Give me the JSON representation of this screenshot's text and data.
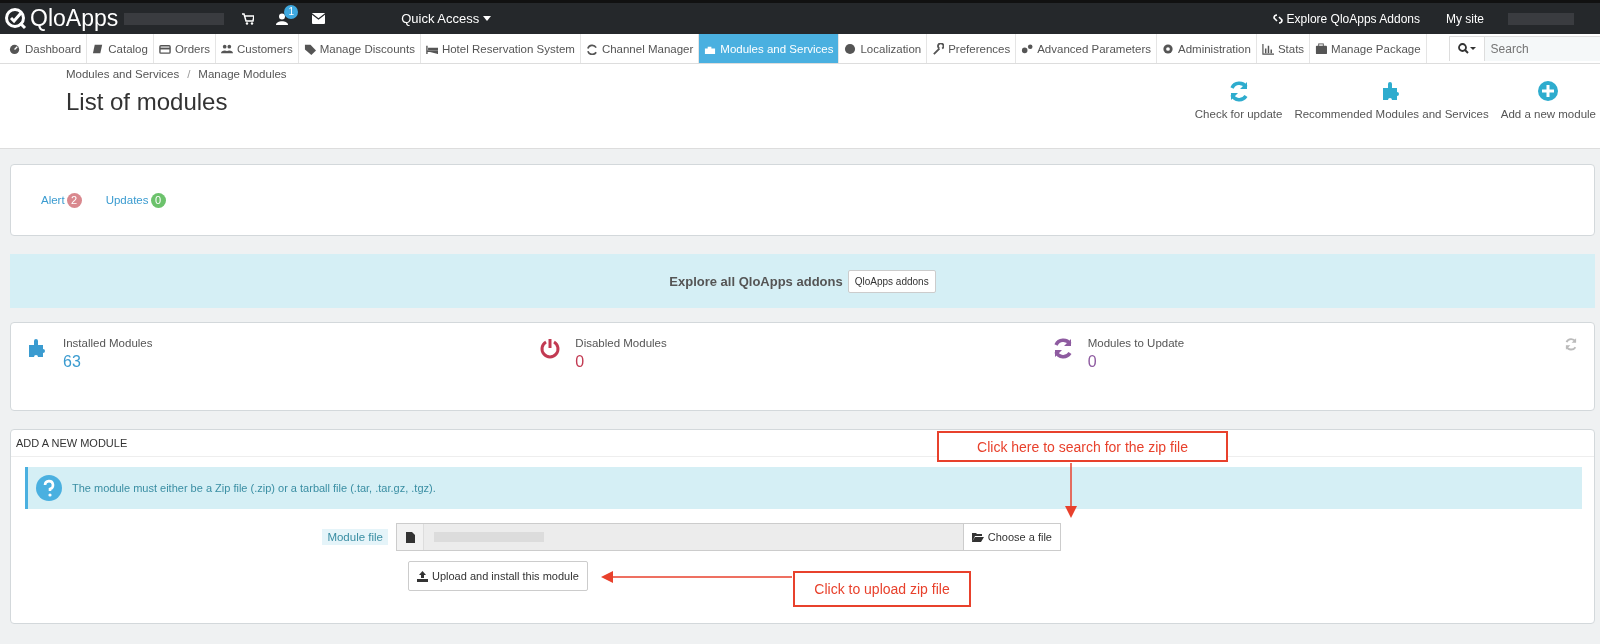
{
  "topbar": {
    "logo": "QloApps",
    "notification_count": "1",
    "quick_access": "Quick Access",
    "explore_link": "Explore QloApps Addons",
    "my_site": "My site"
  },
  "nav": {
    "items": [
      {
        "label": "Dashboard",
        "selected": false
      },
      {
        "label": "Catalog",
        "selected": false
      },
      {
        "label": "Orders",
        "selected": false
      },
      {
        "label": "Customers",
        "selected": false
      },
      {
        "label": "Manage Discounts",
        "selected": false
      },
      {
        "label": "Hotel Reservation System",
        "selected": false
      },
      {
        "label": "Channel Manager",
        "selected": false
      },
      {
        "label": "Modules and Services",
        "selected": true
      },
      {
        "label": "Localization",
        "selected": false
      },
      {
        "label": "Preferences",
        "selected": false
      },
      {
        "label": "Advanced Parameters",
        "selected": false
      },
      {
        "label": "Administration",
        "selected": false
      },
      {
        "label": "Stats",
        "selected": false
      },
      {
        "label": "Manage Package",
        "selected": false
      }
    ],
    "search": {
      "placeholder": "Search"
    }
  },
  "header": {
    "breadcrumb": [
      "Modules and Services",
      "/",
      "Manage Modules"
    ],
    "title": "List of modules",
    "toolbar": [
      {
        "label": "Check for update"
      },
      {
        "label": "Recommended Modules and Services"
      },
      {
        "label": "Add a new module"
      }
    ]
  },
  "filters": [
    {
      "label": "Alert",
      "count": "2",
      "color": "#d9888e"
    },
    {
      "label": "Updates",
      "count": "0",
      "color": "#6cc26c"
    }
  ],
  "banner": {
    "text": "Explore all QloApps addons",
    "button": "QloApps addons"
  },
  "stats": [
    {
      "label": "Installed Modules",
      "value": "63",
      "color": "#3a9bd0"
    },
    {
      "label": "Disabled Modules",
      "value": "0",
      "color": "#c23a52"
    },
    {
      "label": "Modules to Update",
      "value": "0",
      "color": "#8e5ba0"
    }
  ],
  "add_module": {
    "heading": "ADD A NEW MODULE",
    "info": "The module must either be a Zip file (.zip) or a tarball file (.tar, .tar.gz, .tgz).",
    "field_label": "Module file",
    "choose_button": "Choose a file",
    "upload_button": "Upload and install this module"
  },
  "annotations": [
    {
      "text": "Click here to search for the zip file"
    },
    {
      "text": "Click to upload zip file"
    }
  ]
}
